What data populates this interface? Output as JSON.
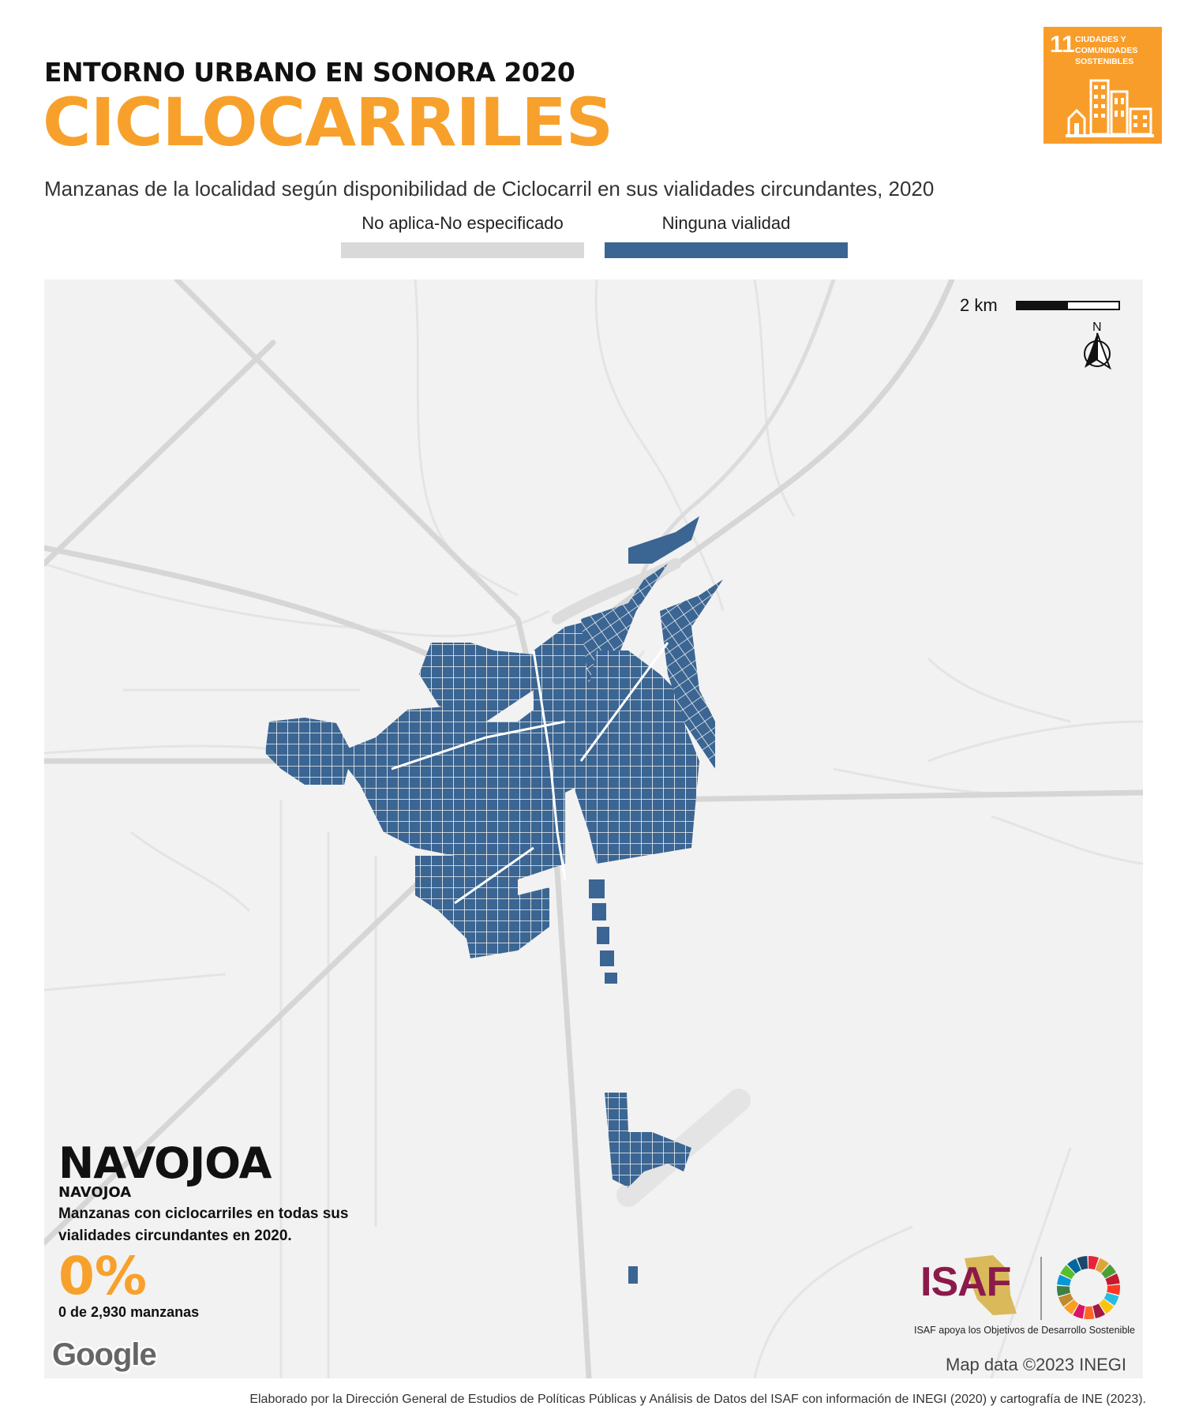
{
  "header": {
    "kicker": "ENTORNO URBANO EN SONORA 2020",
    "title": "CICLOCARRILES",
    "subtitle": "Manzanas de la localidad según disponibilidad de Ciclocarril en sus vialidades circundantes, 2020"
  },
  "sdg_badge": {
    "number": "11",
    "label": "CIUDADES Y\nCOMUNIDADES\nSOSTENIBLES",
    "color": "#f99d2a"
  },
  "legend": [
    {
      "label": "No aplica-No especificado",
      "color": "#d9d9d9"
    },
    {
      "label": "Ninguna vialidad",
      "color": "#3b6592"
    }
  ],
  "map": {
    "scale_label": "2 km",
    "north_label": "N",
    "attribution": "Map data ©2023 INEGI",
    "provider_logo": "Google"
  },
  "locality": {
    "municipality": "NAVOJOA",
    "locality": "NAVOJOA",
    "description": "Manzanas con ciclocarriles en todas sus vialidades circundantes en 2020.",
    "percentage": "0%",
    "count_text": "0 de 2,930 manzanas"
  },
  "branding": {
    "isaf_word": "ISAF",
    "isaf_tagline": "ISAF apoya los Objetivos de Desarrollo Sostenible",
    "isaf_color": "#8b1a4a"
  },
  "footer": {
    "credit": "Elaborado por la Dirección General de Estudios de Políticas Públicas y Análisis de Datos del ISAF con información de INEGI (2020) y cartografía de INE (2023)."
  }
}
